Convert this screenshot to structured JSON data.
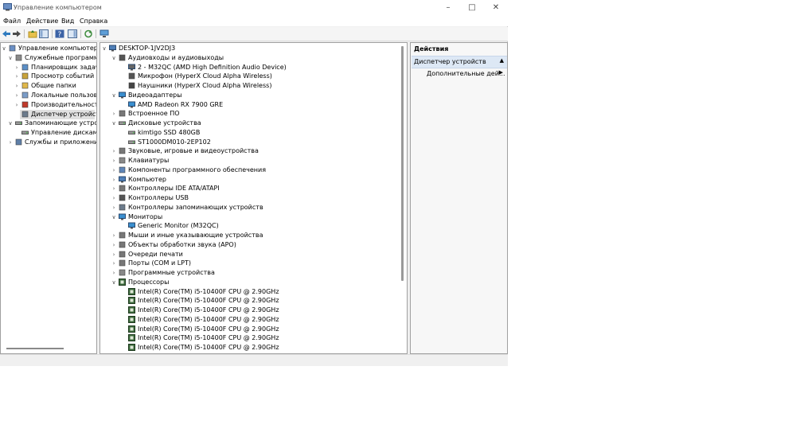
{
  "window": {
    "title": "Управление компьютером"
  },
  "menu": [
    "Файл",
    "Действие",
    "Вид",
    "Справка"
  ],
  "left_tree": [
    {
      "label": "Управление компьютером (л",
      "level": 0,
      "arrow": "v",
      "icon": "computer-management-icon"
    },
    {
      "label": "Служебные программы",
      "level": 1,
      "arrow": "v",
      "icon": "tools-icon"
    },
    {
      "label": "Планировщик задач",
      "level": 2,
      "arrow": ">",
      "icon": "task-scheduler-icon"
    },
    {
      "label": "Просмотр событий",
      "level": 2,
      "arrow": ">",
      "icon": "event-viewer-icon"
    },
    {
      "label": "Общие папки",
      "level": 2,
      "arrow": ">",
      "icon": "shared-folders-icon"
    },
    {
      "label": "Локальные пользовате",
      "level": 2,
      "arrow": ">",
      "icon": "local-users-icon"
    },
    {
      "label": "Производительность",
      "level": 2,
      "arrow": ">",
      "icon": "performance-icon"
    },
    {
      "label": "Диспетчер устройств",
      "level": 2,
      "arrow": "",
      "icon": "device-manager-icon",
      "selected": true
    },
    {
      "label": "Запоминающие устройст",
      "level": 1,
      "arrow": "v",
      "icon": "storage-icon"
    },
    {
      "label": "Управление дисками",
      "level": 2,
      "arrow": "",
      "icon": "disk-management-icon"
    },
    {
      "label": "Службы и приложения",
      "level": 1,
      "arrow": ">",
      "icon": "services-icon"
    }
  ],
  "device_tree": [
    {
      "label": "DESKTOP-1JV2DJ3",
      "level": 0,
      "arrow": "v",
      "icon": "computer-icon"
    },
    {
      "label": "Аудиовходы и аудиовыходы",
      "level": 1,
      "arrow": "v",
      "icon": "speaker-icon"
    },
    {
      "label": "2 - M32QC (AMD High Definition Audio Device)",
      "level": 2,
      "arrow": "",
      "icon": "monitor-audio-icon"
    },
    {
      "label": "Микрофон (HyperX Cloud Alpha Wireless)",
      "level": 2,
      "arrow": "",
      "icon": "microphone-icon"
    },
    {
      "label": "Наушники (HyperX Cloud Alpha Wireless)",
      "level": 2,
      "arrow": "",
      "icon": "headphones-icon"
    },
    {
      "label": "Видеоадаптеры",
      "level": 1,
      "arrow": "v",
      "icon": "display-adapter-icon"
    },
    {
      "label": "AMD Radeon RX 7900 GRE",
      "level": 2,
      "arrow": "",
      "icon": "display-adapter-icon"
    },
    {
      "label": "Встроенное ПО",
      "level": 1,
      "arrow": ">",
      "icon": "firmware-icon"
    },
    {
      "label": "Дисковые устройства",
      "level": 1,
      "arrow": "v",
      "icon": "disk-drive-icon"
    },
    {
      "label": "kimtigo SSD 480GB",
      "level": 2,
      "arrow": "",
      "icon": "disk-drive-icon"
    },
    {
      "label": "ST1000DM010-2EP102",
      "level": 2,
      "arrow": "",
      "icon": "disk-drive-icon"
    },
    {
      "label": "Звуковые, игровые и видеоустройства",
      "level": 1,
      "arrow": ">",
      "icon": "sound-icon"
    },
    {
      "label": "Клавиатуры",
      "level": 1,
      "arrow": ">",
      "icon": "keyboard-icon"
    },
    {
      "label": "Компоненты программного обеспечения",
      "level": 1,
      "arrow": ">",
      "icon": "software-component-icon"
    },
    {
      "label": "Компьютер",
      "level": 1,
      "arrow": ">",
      "icon": "computer-icon"
    },
    {
      "label": "Контроллеры IDE ATA/ATAPI",
      "level": 1,
      "arrow": ">",
      "icon": "ide-controller-icon"
    },
    {
      "label": "Контроллеры USB",
      "level": 1,
      "arrow": ">",
      "icon": "usb-icon"
    },
    {
      "label": "Контроллеры запоминающих устройств",
      "level": 1,
      "arrow": ">",
      "icon": "storage-controller-icon"
    },
    {
      "label": "Мониторы",
      "level": 1,
      "arrow": "v",
      "icon": "monitor-icon"
    },
    {
      "label": "Generic Monitor (M32QC)",
      "level": 2,
      "arrow": "",
      "icon": "monitor-icon"
    },
    {
      "label": "Мыши и иные указывающие устройства",
      "level": 1,
      "arrow": ">",
      "icon": "mouse-icon"
    },
    {
      "label": "Объекты обработки звука (APO)",
      "level": 1,
      "arrow": ">",
      "icon": "audio-processing-icon"
    },
    {
      "label": "Очереди печати",
      "level": 1,
      "arrow": ">",
      "icon": "printer-icon"
    },
    {
      "label": "Порты (COM и LPT)",
      "level": 1,
      "arrow": ">",
      "icon": "port-icon"
    },
    {
      "label": "Программные устройства",
      "level": 1,
      "arrow": ">",
      "icon": "software-device-icon"
    },
    {
      "label": "Процессоры",
      "level": 1,
      "arrow": "v",
      "icon": "cpu-icon"
    },
    {
      "label": "Intel(R) Core(TM) i5-10400F CPU @ 2.90GHz",
      "level": 2,
      "arrow": "",
      "icon": "cpu-icon"
    },
    {
      "label": "Intel(R) Core(TM) i5-10400F CPU @ 2.90GHz",
      "level": 2,
      "arrow": "",
      "icon": "cpu-icon"
    },
    {
      "label": "Intel(R) Core(TM) i5-10400F CPU @ 2.90GHz",
      "level": 2,
      "arrow": "",
      "icon": "cpu-icon"
    },
    {
      "label": "Intel(R) Core(TM) i5-10400F CPU @ 2.90GHz",
      "level": 2,
      "arrow": "",
      "icon": "cpu-icon"
    },
    {
      "label": "Intel(R) Core(TM) i5-10400F CPU @ 2.90GHz",
      "level": 2,
      "arrow": "",
      "icon": "cpu-icon"
    },
    {
      "label": "Intel(R) Core(TM) i5-10400F CPU @ 2.90GHz",
      "level": 2,
      "arrow": "",
      "icon": "cpu-icon"
    },
    {
      "label": "Intel(R) Core(TM) i5-10400F CPU @ 2.90GHz",
      "level": 2,
      "arrow": "",
      "icon": "cpu-icon"
    }
  ],
  "actions": {
    "header": "Действия",
    "section": "Диспетчер устройств",
    "more": "Дополнительные дей..."
  },
  "colors": {
    "selection": "#e0e0e0",
    "actions_section": "#dde8f5"
  }
}
